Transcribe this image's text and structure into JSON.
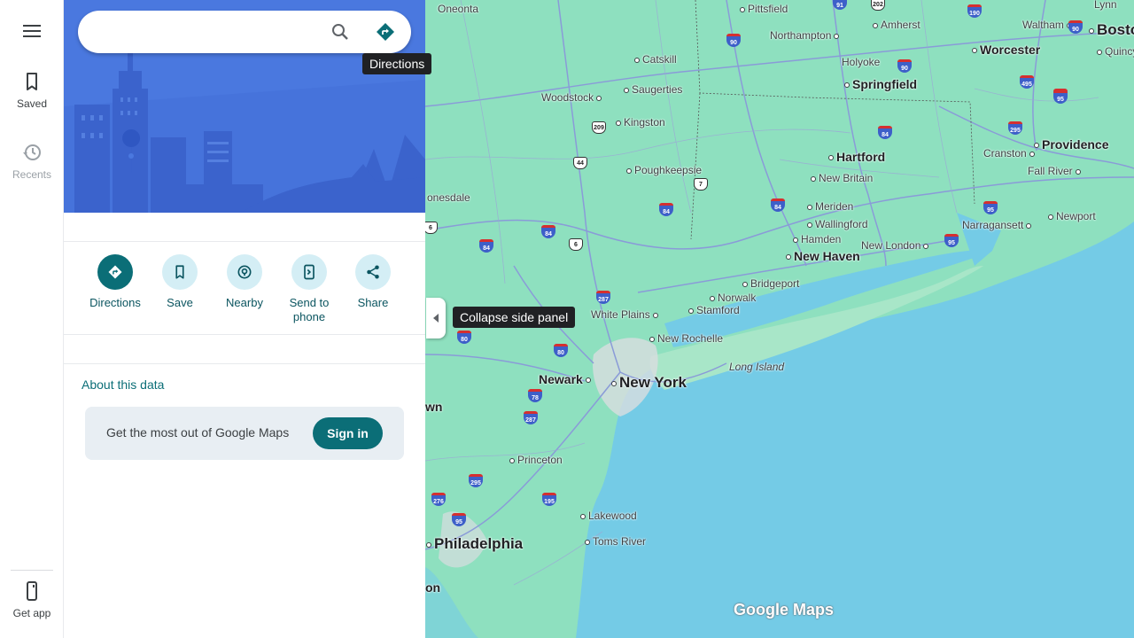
{
  "rail": {
    "saved": "Saved",
    "recents": "Recents",
    "get_app": "Get app"
  },
  "search": {
    "value": ""
  },
  "tooltips": {
    "directions": "Directions",
    "collapse": "Collapse side panel"
  },
  "actions": [
    {
      "label": "Directions",
      "icon": "directions-icon"
    },
    {
      "label": "Save",
      "icon": "bookmark-icon"
    },
    {
      "label": "Nearby",
      "icon": "nearby-icon"
    },
    {
      "label": "Send to\nphone",
      "icon": "send-to-phone-icon"
    },
    {
      "label": "Share",
      "icon": "share-icon"
    }
  ],
  "about": {
    "title": "About this data"
  },
  "promo": {
    "text": "Get the most out of Google Maps",
    "button": "Sign in"
  },
  "map": {
    "wordmark": "Google Maps",
    "cities": [
      "Oneonta",
      "Pittsfield",
      "Amherst",
      "Worcester",
      "Boston",
      "Quincy",
      "Lynn",
      "Waltham",
      "Northampton",
      "Catskill",
      "Woodstock",
      "Saugerties",
      "Holyoke",
      "Springfield",
      "Kingston",
      "Poughkeepsie",
      "Hartford",
      "Providence",
      "Cranston",
      "Fall River",
      "New Britain",
      "Meriden",
      "Wallingford",
      "Newport",
      "Narragansett",
      "Hamden",
      "New London",
      "New Haven",
      "Bridgeport",
      "Norwalk",
      "Stamford",
      "White Plains",
      "New Rochelle",
      "Long Island",
      "Newark",
      "New York",
      "Princeton",
      "Lakewood",
      "Toms River",
      "Philadelphia",
      "onesdale",
      "wn",
      "on"
    ],
    "highways": [
      "90",
      "91",
      "202",
      "190",
      "90",
      "495",
      "95",
      "90",
      "84",
      "295",
      "84",
      "95",
      "84",
      "95",
      "95",
      "209",
      "44",
      "7",
      "84",
      "84",
      "6",
      "287",
      "80",
      "80",
      "78",
      "287",
      "295",
      "195",
      "276",
      "95",
      "6"
    ]
  },
  "colors": {
    "accent": "#0b6e77",
    "water": "#74cbe6",
    "land": "#8ee0bf",
    "hero": "#4b78e0"
  }
}
